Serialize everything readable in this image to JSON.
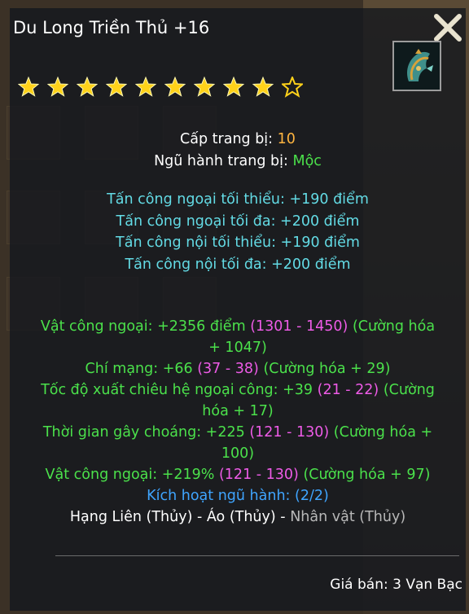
{
  "item": {
    "name": "Du Long Triền Thủ +16",
    "stars_total": 10,
    "stars_filled": 9
  },
  "basic": [
    {
      "label": "Cấp trang bị:",
      "value": "10"
    },
    {
      "label": "Ngũ hành trang bị:",
      "value": "Mộc"
    }
  ],
  "base_stats": [
    "Tấn công ngoại tối thiểu: +190 điểm",
    "Tấn công ngoại tối đa: +200 điểm",
    "Tấn công nội tối thiểu: +190 điểm",
    "Tấn công nội tối đa: +200 điểm"
  ],
  "mods": [
    {
      "a": "Vật công ngoại: +2356 điểm",
      "range": "(1301 - 1450)",
      "b": "(Cường hóa",
      "c": "+ 1047)"
    },
    {
      "a": "Chí mạng: +66",
      "range": "(37 - 38)",
      "b": "(Cường hóa + 29)"
    },
    {
      "a": "Tốc độ xuất chiêu hệ ngoại công: +39",
      "range": "(21 - 22)",
      "b": "(Cường",
      "c": "hóa + 17)"
    },
    {
      "a": "Thời gian gây choáng: +225",
      "range": "(121 - 130)",
      "b": "(Cường hóa +",
      "c": "100)"
    },
    {
      "a": "Vật công ngoại: +219%",
      "range": "(121 - 130)",
      "b": "(Cường hóa + 97)"
    }
  ],
  "element_activation": {
    "label": "Kích hoạt ngũ hành:",
    "value": "(2/2)"
  },
  "set_items": {
    "part1": "Hạng Liên (Thủy)",
    "sep": "-",
    "part2": "Áo (Thủy)",
    "part3": "Nhân vật (Thủy)"
  },
  "price": "Giá bán: 3 Vạn Bạc",
  "colors": {
    "white": "#ffffff",
    "orange": "#ffb540",
    "green": "#4be14b",
    "cyan": "#63dbe5",
    "pink": "#ee5be7",
    "blue": "#3fa5ff",
    "star": "#ffd21a"
  }
}
